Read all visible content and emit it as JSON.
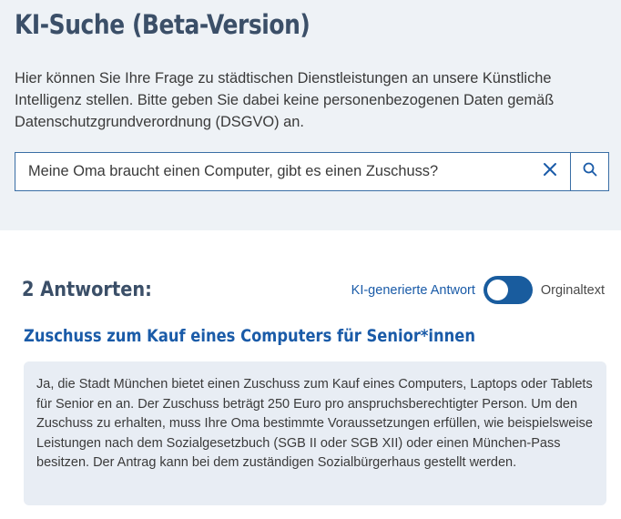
{
  "header": {
    "title": "KI-Suche (Beta-Version)",
    "intro": "Hier können Sie Ihre Frage zu städtischen Dienstleistungen an unsere Künstliche Intelligenz stellen. Bitte geben Sie dabei keine personenbezogenen Daten gemäß Datenschutzgrundverordnung (DSGVO) an."
  },
  "search": {
    "value": "Meine Oma braucht einen Computer, gibt es einen Zuschuss?"
  },
  "results": {
    "count_label": "2 Antworten:",
    "toggle": {
      "left_label": "KI-generierte Antwort",
      "right_label": "Orginaltext",
      "selected": "KI-generierte Antwort"
    },
    "items": [
      {
        "title": "Zuschuss zum Kauf eines Computers für Senior*innen",
        "text": "Ja, die Stadt München bietet einen Zuschuss zum Kauf eines Computers, Laptops oder Tablets für Senior en an. Der Zuschuss beträgt 250 Euro pro anspruchsberechtigter Person. Um den Zuschuss zu erhalten, muss Ihre Oma bestimmte Voraussetzungen erfüllen, wie beispielsweise Leistungen nach dem Sozialgesetzbuch (SGB II oder SGB XII) oder einen München-Pass besitzen. Der Antrag kann bei dem zuständigen Sozialbürgerhaus gestellt werden."
      }
    ]
  },
  "colors": {
    "heading": "#3b4f68",
    "accent": "#1a5ba8",
    "toggle": "#195c9e",
    "top_background": "#eef2f6",
    "result_background": "#e8edf4"
  },
  "icons": {
    "clear": "close-icon",
    "search": "search-icon"
  }
}
